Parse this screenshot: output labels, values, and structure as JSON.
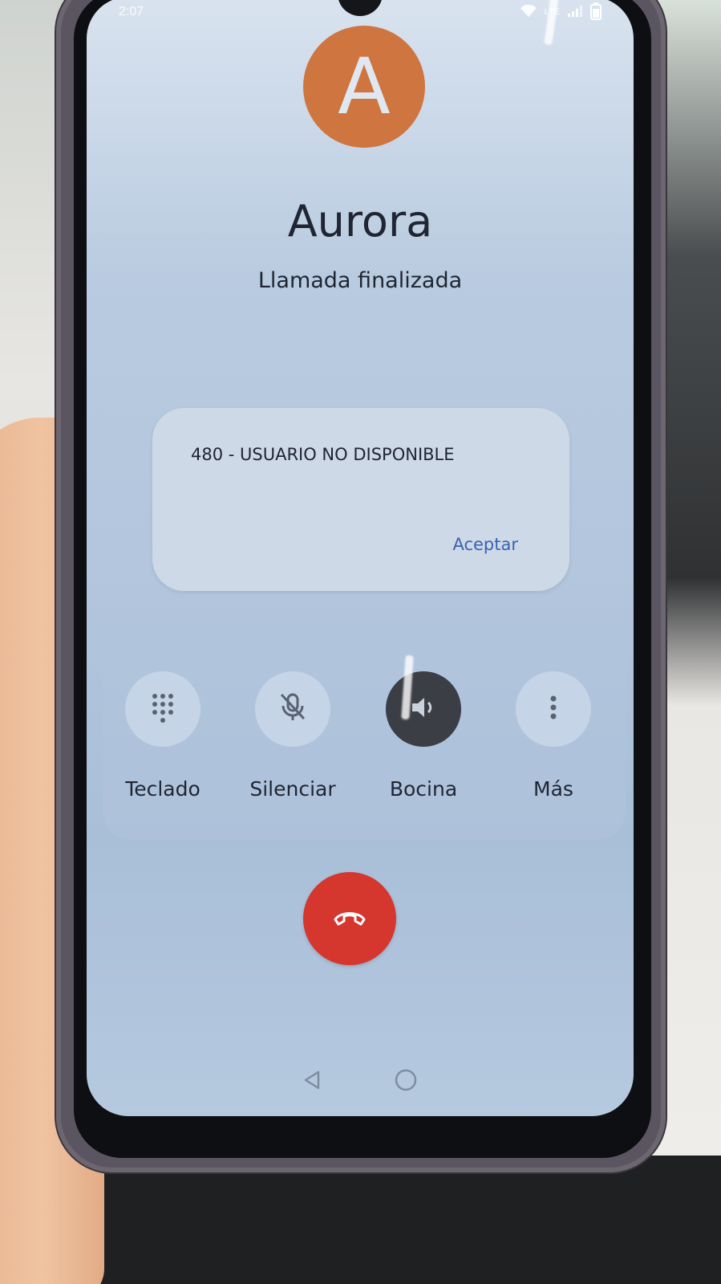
{
  "status_bar": {
    "time": "2:07",
    "network": "LTE",
    "icons": [
      "wifi-icon",
      "signal-icon",
      "battery-icon"
    ]
  },
  "caller": {
    "avatar_letter": "A",
    "avatar_color": "#cf7540",
    "name": "Aurora",
    "status": "Llamada finalizada"
  },
  "dialog": {
    "message": "480 - USUARIO NO DISPONIBLE",
    "button_label": "Aceptar"
  },
  "controls": [
    {
      "label": "Teclado",
      "icon": "dialpad-icon",
      "active": false
    },
    {
      "label": "Silenciar",
      "icon": "mic-off-icon",
      "active": false
    },
    {
      "label": "Bocina",
      "icon": "speaker-icon",
      "active": true
    },
    {
      "label": "Más",
      "icon": "more-vert-icon",
      "active": false
    }
  ],
  "end_call": {
    "icon": "call-end-icon",
    "color": "#d5362e"
  },
  "nav_bar": {
    "icons": [
      "back-icon",
      "home-icon"
    ]
  }
}
